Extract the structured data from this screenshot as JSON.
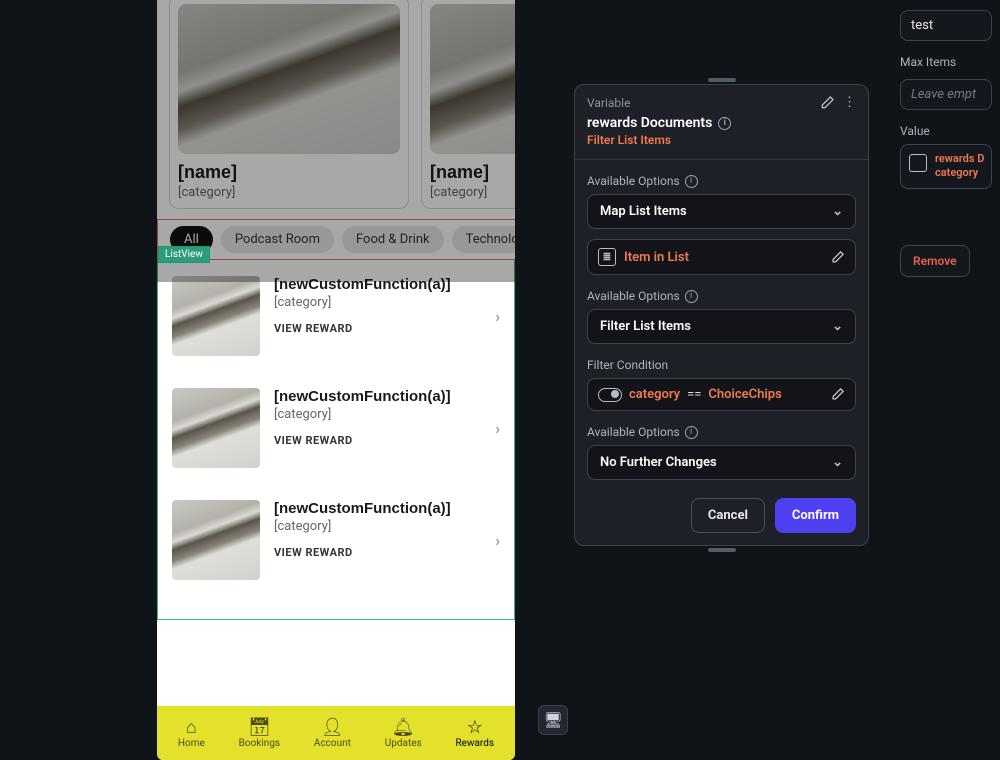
{
  "phone": {
    "cards": [
      {
        "name": "[name]",
        "category": "[category]"
      },
      {
        "name": "[name]",
        "category": "[category]"
      }
    ],
    "chips": [
      "All",
      "Podcast Room",
      "Food & Drink",
      "Technology"
    ],
    "chip_active_index": 0,
    "listview_badge": "ListView",
    "list_rows": [
      {
        "title": "[newCustomFunction(a)]",
        "category": "[category]",
        "action": "VIEW REWARD"
      },
      {
        "title": "[newCustomFunction(a)]",
        "category": "[category]",
        "action": "VIEW REWARD"
      },
      {
        "title": "[newCustomFunction(a)]",
        "category": "[category]",
        "action": "VIEW REWARD"
      }
    ],
    "bottom_nav": [
      {
        "label": "Home",
        "icon": "home-icon"
      },
      {
        "label": "Bookings",
        "icon": "calendar-icon"
      },
      {
        "label": "Account",
        "icon": "person-icon"
      },
      {
        "label": "Updates",
        "icon": "bell-icon"
      },
      {
        "label": "Rewards",
        "icon": "star-icon"
      }
    ],
    "nav_active_index": 4
  },
  "panel": {
    "variable_label": "Variable",
    "title": "rewards Documents",
    "subtitle": "Filter List Items",
    "sections": {
      "available_options": "Available Options",
      "filter_condition": "Filter Condition"
    },
    "select1": "Map List Items",
    "item_in_list": "Item in List",
    "select2": "Filter List Items",
    "filter_expr": {
      "field": "category",
      "op": "==",
      "value": "ChoiceChips"
    },
    "select3": "No Further Changes",
    "buttons": {
      "cancel": "Cancel",
      "confirm": "Confirm"
    }
  },
  "right": {
    "test_value": "test",
    "max_items_label": "Max Items",
    "max_items_placeholder": "Leave empt",
    "value_label": "Value",
    "value_chip_line1": "rewards D",
    "value_chip_line2": "category",
    "remove": "Remove"
  }
}
